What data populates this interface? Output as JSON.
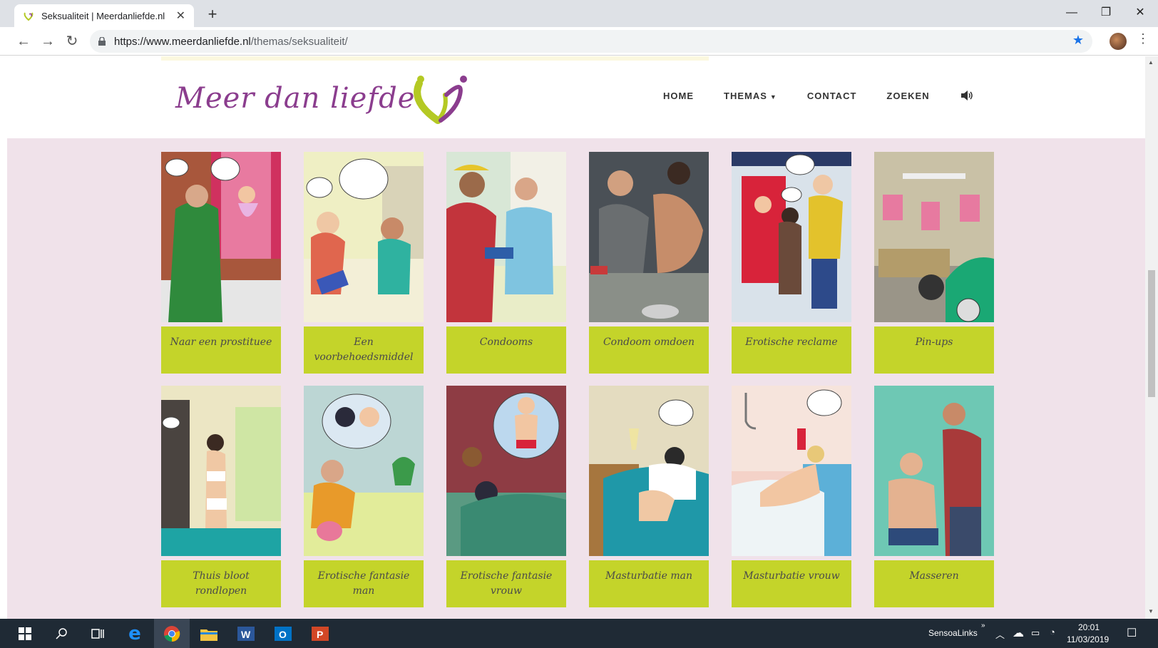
{
  "browser": {
    "tab_title": "Seksualiteit | Meerdanliefde.nl",
    "url_domain": "https://www.meerdanliefde.nl",
    "url_path": "/themas/seksualiteit/",
    "new_tab": "+",
    "close_tab": "✕",
    "window_minimize": "—",
    "window_restore": "❐",
    "window_close": "✕"
  },
  "site": {
    "logo_text": "Meer dan liefde",
    "nav": {
      "home": "HOME",
      "themas": "THEMAS",
      "contact": "CONTACT",
      "zoeken": "ZOEKEN"
    },
    "colors": {
      "accent_green": "#c4d42a",
      "brand_purple": "#8b3d8e",
      "page_background": "#f0e2ea"
    }
  },
  "cards": [
    {
      "label": "Naar een prostituee",
      "icon": "illustration"
    },
    {
      "label": "Een voorbehoedsmiddel",
      "icon": "illustration"
    },
    {
      "label": "Condooms",
      "icon": "illustration"
    },
    {
      "label": "Condoom omdoen",
      "icon": "illustration"
    },
    {
      "label": "Erotische reclame",
      "icon": "illustration"
    },
    {
      "label": "Pin-ups",
      "icon": "illustration"
    },
    {
      "label": "Thuis bloot rondlopen",
      "icon": "illustration"
    },
    {
      "label": "Erotische fantasie man",
      "icon": "illustration"
    },
    {
      "label": "Erotische fantasie vrouw",
      "icon": "illustration"
    },
    {
      "label": "Masturbatie man",
      "icon": "illustration"
    },
    {
      "label": "Masturbatie vrouw",
      "icon": "illustration"
    },
    {
      "label": "Masseren",
      "icon": "illustration"
    }
  ],
  "taskbar": {
    "tray_label": "SensoaLinks",
    "time": "20:01",
    "date": "11/03/2019"
  }
}
